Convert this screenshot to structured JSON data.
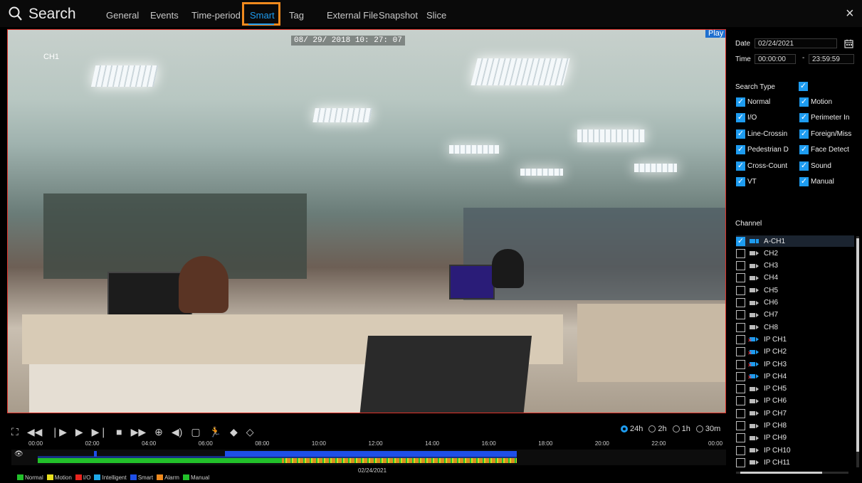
{
  "header": {
    "title": "Search",
    "tabs": [
      "General",
      "Events",
      "Time-period",
      "Smart",
      "Tag",
      "External File",
      "Snapshot",
      "Slice"
    ],
    "active_tab": "Smart",
    "close_symbol": "×"
  },
  "video": {
    "osd_datetime": "08/ 29/ 2018  10: 27: 07",
    "osd_channel": "CH1",
    "play_label": "Play"
  },
  "controls": {
    "icons": [
      "fullscreen-icon",
      "rewind-icon",
      "step-back-icon",
      "play-icon",
      "step-forward-icon",
      "stop-icon",
      "fast-forward-icon",
      "zoom-icon",
      "audio-icon",
      "snapshot-icon",
      "smart-human-icon",
      "tag-icon",
      "add-tag-icon"
    ],
    "zoom_options": [
      "24h",
      "2h",
      "1h",
      "30m"
    ],
    "zoom_selected": "24h"
  },
  "timeline": {
    "hours": [
      "00:00",
      "02:00",
      "04:00",
      "06:00",
      "08:00",
      "10:00",
      "12:00",
      "14:00",
      "16:00",
      "18:00",
      "20:00",
      "22:00",
      "00:00"
    ],
    "date": "02/24/2021",
    "legend": [
      {
        "label": "Normal",
        "color": "#22c02a"
      },
      {
        "label": "Motion",
        "color": "#e8e01e"
      },
      {
        "label": "I/O",
        "color": "#e8241e"
      },
      {
        "label": "Intelligent",
        "color": "#1ea8e8"
      },
      {
        "label": "Smart",
        "color": "#1e4fe8"
      },
      {
        "label": "Alarm",
        "color": "#ef8a1e"
      },
      {
        "label": "Manual",
        "color": "#22c02a"
      }
    ]
  },
  "panel": {
    "date_label": "Date",
    "date_value": "02/24/2021",
    "time_label": "Time",
    "time_start": "00:00:00",
    "time_sep": "-",
    "time_end": "23:59:59",
    "search_type_label": "Search Type",
    "search_types": [
      "Normal",
      "Motion",
      "I/O",
      "Perimeter In",
      "Line-Crossin",
      "Foreign/Miss",
      "Pedestrian D",
      "Face Detect",
      "Cross-Count",
      "Sound",
      "VT",
      "Manual"
    ],
    "channel_label": "Channel",
    "channels": [
      "A-CH1",
      "CH2",
      "CH3",
      "CH4",
      "CH5",
      "CH6",
      "CH7",
      "CH8",
      "IP CH1",
      "IP CH2",
      "IP CH3",
      "IP CH4",
      "IP CH5",
      "IP CH6",
      "IP CH7",
      "IP CH8",
      "IP CH9",
      "IP CH10",
      "IP CH11"
    ],
    "channel_selected": "A-CH1"
  }
}
